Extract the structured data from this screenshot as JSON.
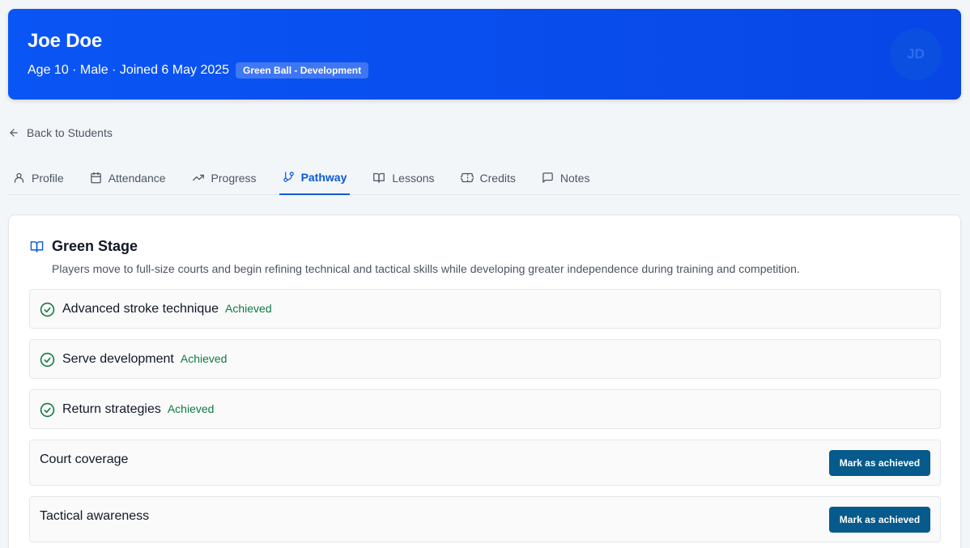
{
  "header": {
    "name": "Joe Doe",
    "meta": "Age 10 · Male · Joined 6 May 2025",
    "badge": "Green Ball - Development",
    "avatar_initials": "JD",
    "colors": {
      "primary": "#0a55f5",
      "avatar_bg": "#0b4fe0"
    }
  },
  "back_link": {
    "label": "Back to Students",
    "icon": "arrow-left-icon"
  },
  "tabs": [
    {
      "label": "Profile",
      "icon": "user-icon",
      "active": false
    },
    {
      "label": "Attendance",
      "icon": "calendar-icon",
      "active": false
    },
    {
      "label": "Progress",
      "icon": "trending-up-icon",
      "active": false
    },
    {
      "label": "Pathway",
      "icon": "git-branch-icon",
      "active": true
    },
    {
      "label": "Lessons",
      "icon": "book-open-icon",
      "active": false
    },
    {
      "label": "Credits",
      "icon": "ticket-icon",
      "active": false
    },
    {
      "label": "Notes",
      "icon": "message-square-icon",
      "active": false
    }
  ],
  "stage": {
    "title": "Green Stage",
    "icon": "book-open-icon",
    "description": "Players move to full-size courts and begin refining technical and tactical skills while developing greater independence during training and competition.",
    "skills": [
      {
        "name": "Advanced stroke technique",
        "status": "Achieved",
        "achieved": true
      },
      {
        "name": "Serve development",
        "status": "Achieved",
        "achieved": true
      },
      {
        "name": "Return strategies",
        "status": "Achieved",
        "achieved": true
      },
      {
        "name": "Court coverage",
        "achieved": false,
        "action": "Mark as achieved"
      },
      {
        "name": "Tactical awareness",
        "achieved": false,
        "action": "Mark as achieved"
      }
    ]
  },
  "colors": {
    "accent": "#0b5ad8",
    "achieved": "#0f7a45",
    "button": "#065a8c"
  }
}
